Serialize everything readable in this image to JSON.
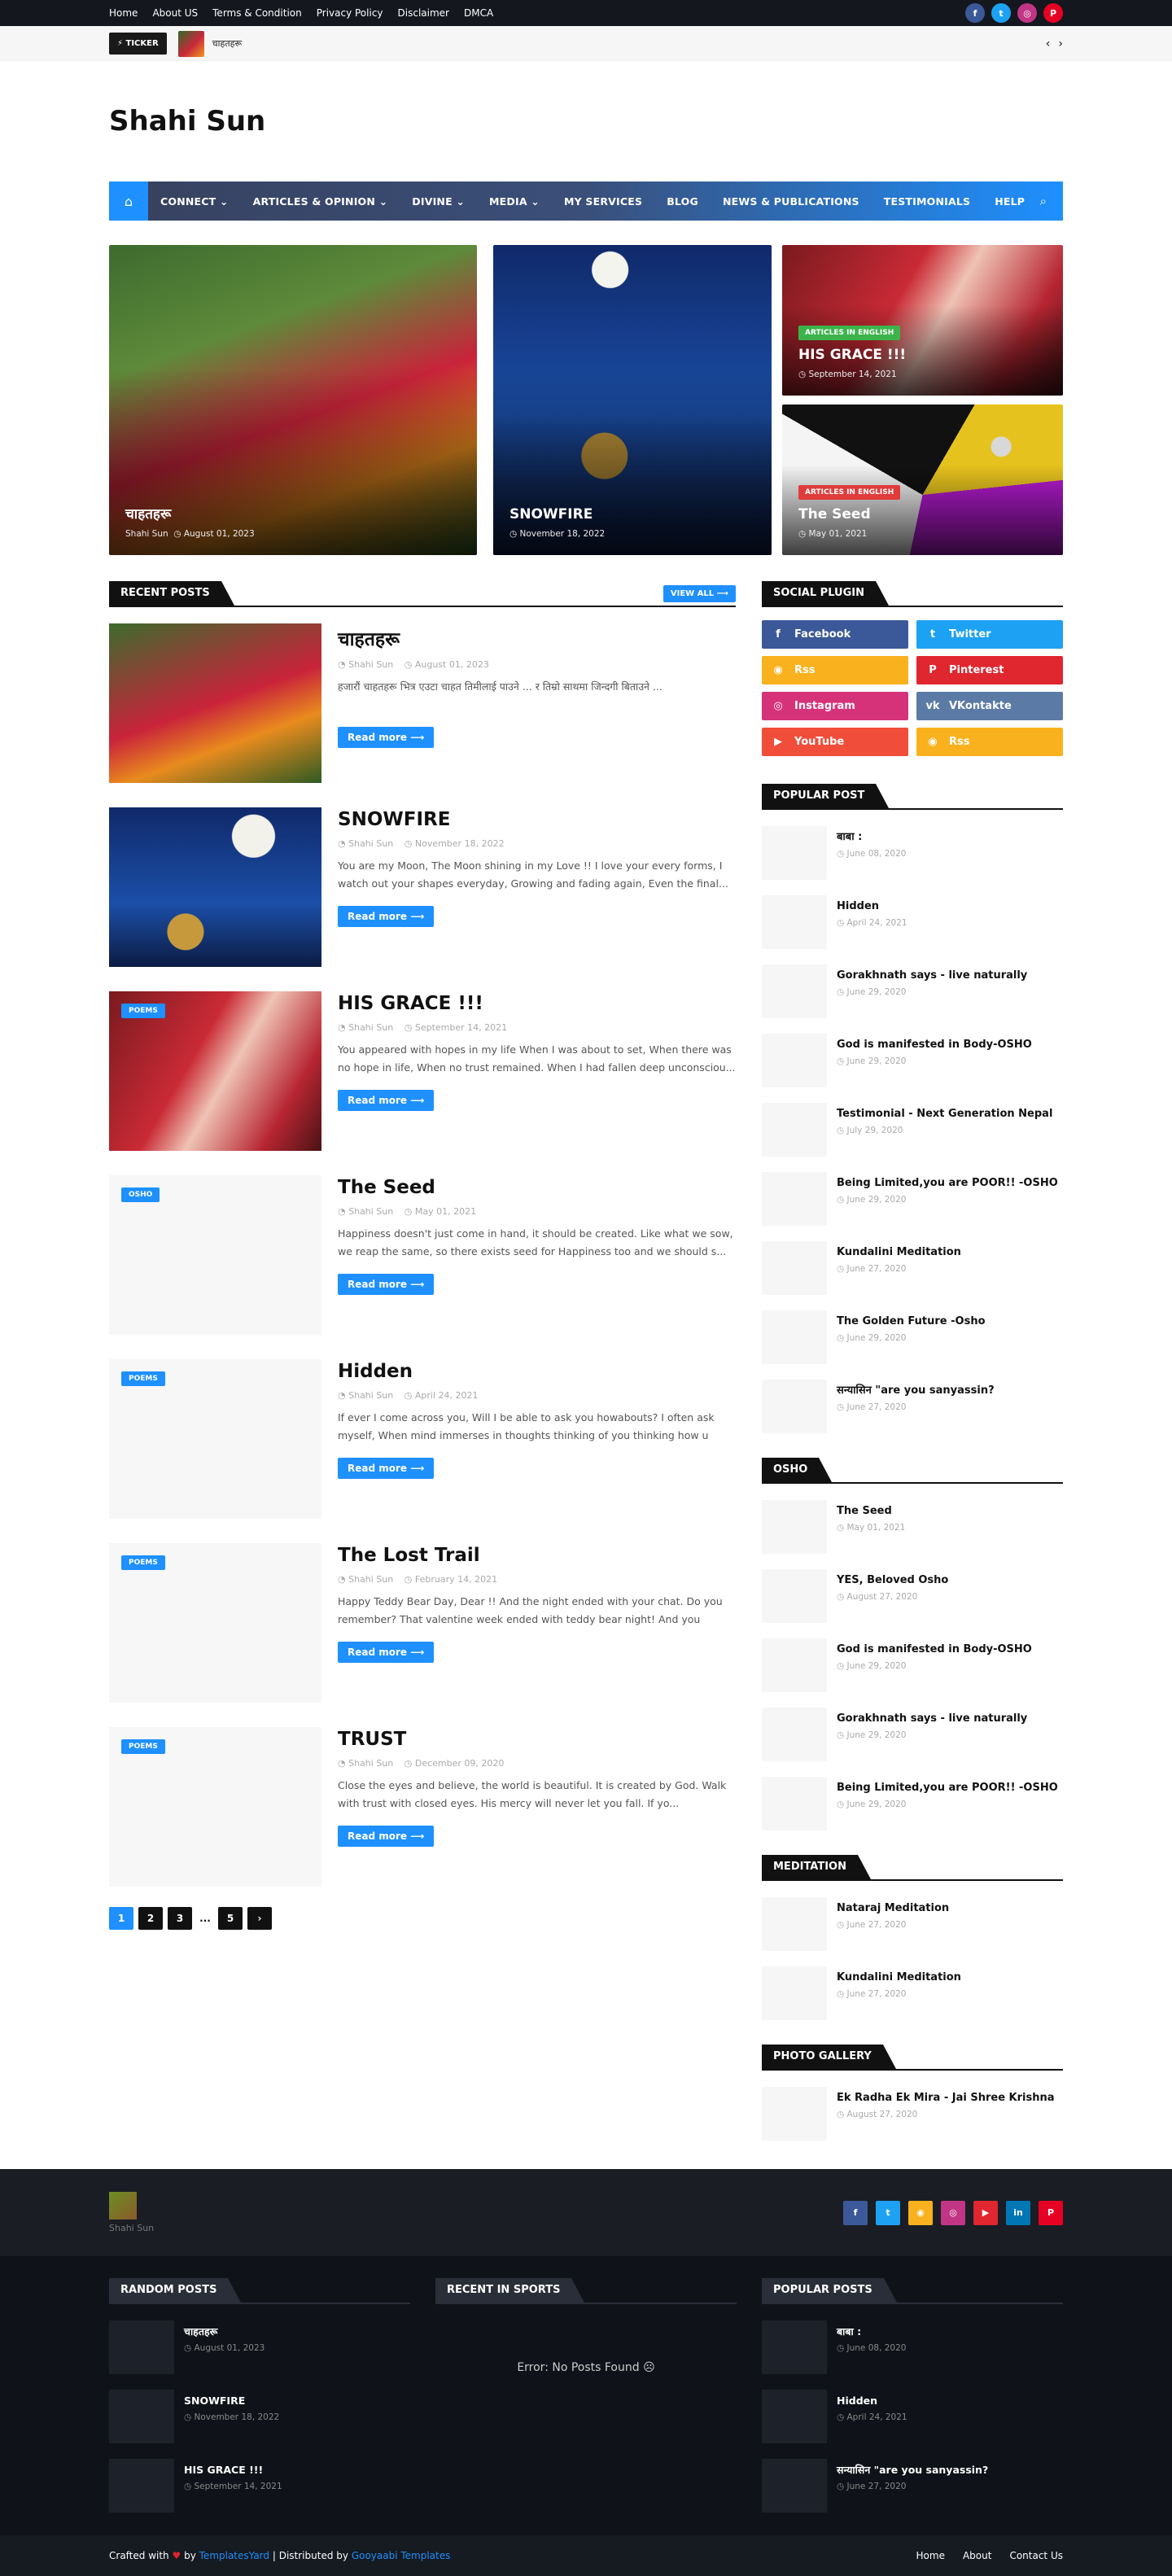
{
  "topbar": {
    "links": [
      "Home",
      "About US",
      "Terms & Condition",
      "Privacy Policy",
      "Disclaimer",
      "DMCA"
    ],
    "social": [
      {
        "icon": "facebook-icon",
        "glyph": "f",
        "color": "#3b5998"
      },
      {
        "icon": "twitter-icon",
        "glyph": "t",
        "color": "#1da1f2"
      },
      {
        "icon": "instagram-icon",
        "glyph": "◎",
        "color": "#c13584"
      },
      {
        "icon": "pinterest-icon",
        "glyph": "P",
        "color": "#e60023"
      }
    ]
  },
  "ticker": {
    "label": "⚡ TICKER",
    "text": "चाहतहरू",
    "prev": "‹",
    "next": "›"
  },
  "header": {
    "site_title": "Shahi Sun"
  },
  "nav": {
    "home_icon": "⌂",
    "items": [
      "CONNECT ⌄",
      "ARTICLES & OPINION ⌄",
      "DIVINE ⌄",
      "MEDIA ⌄",
      "MY SERVICES",
      "BLOG",
      "NEWS & PUBLICATIONS",
      "TESTIMONIALS",
      "HELP"
    ],
    "search_icon": "⌕"
  },
  "featured": [
    {
      "title": "चाहतहरू",
      "author": "Shahi Sun",
      "date": "August 01, 2023",
      "tag": ""
    },
    {
      "title": "SNOWFIRE",
      "author": "",
      "date": "November 18, 2022",
      "tag": ""
    },
    {
      "title": "HIS GRACE !!!",
      "author": "",
      "date": "September 14, 2021",
      "tag": "ARTICLES IN ENGLISH",
      "tag_color": "#3cb44b"
    },
    {
      "title": "The Seed",
      "author": "",
      "date": "May 01, 2021",
      "tag": "ARTICLES IN ENGLISH",
      "tag_color": "#e03c3c"
    }
  ],
  "recent": {
    "heading": "RECENT POSTS",
    "view_all": "VIEW ALL ⟶",
    "read_more": "Read more ⟶",
    "posts": [
      {
        "title": "चाहतहरू",
        "author": "Shahi Sun",
        "date": "August 01, 2023",
        "excerpt": "हजारौं चाहतहरू भित्र एउटा चाहत तिमीलाई पाउने ... र तिम्रो साथमा जिन्दगी बिताउने ...",
        "badge": ""
      },
      {
        "title": "SNOWFIRE",
        "author": "Shahi Sun",
        "date": "November 18, 2022",
        "excerpt": "You are my Moon, The Moon shining in my Love !! I love your every forms, I watch out your shapes everyday, Growing and fading again, Even the final...",
        "badge": ""
      },
      {
        "title": "HIS GRACE !!!",
        "author": "Shahi Sun",
        "date": "September 14, 2021",
        "excerpt": "You appeared with hopes in my life When I was about to set, When there was no hope in life, When no trust remained. When I had fallen deep unconsciou...",
        "badge": "POEMS"
      },
      {
        "title": "The Seed",
        "author": "Shahi Sun",
        "date": "May 01, 2021",
        "excerpt": "Happiness doesn't just come in hand, it should be created. Like what we sow, we reap the same, so there exists seed for Happiness too and we should s...",
        "badge": "OSHO"
      },
      {
        "title": "Hidden",
        "author": "Shahi Sun",
        "date": "April 24, 2021",
        "excerpt": "If ever I come across you, Will I be able to ask you howabouts? I often ask myself, When mind immerses in thoughts thinking of you thinking how u mus...",
        "badge": "POEMS"
      },
      {
        "title": "The Lost Trail",
        "author": "Shahi Sun",
        "date": "February 14, 2021",
        "excerpt": "Happy Teddy Bear Day, Dear !!  And the night ended with your chat. Do you remember? That valentine week ended with teddy bear night! And you promised...",
        "badge": "POEMS"
      },
      {
        "title": "TRUST",
        "author": "Shahi Sun",
        "date": "December 09, 2020",
        "excerpt": "Close the eyes and believe, the world is beautiful. It is created by God. Walk with trust with closed eyes. His mercy will never let you fall. If yo...",
        "badge": "POEMS"
      }
    ],
    "pager": [
      "1",
      "2",
      "3",
      "...",
      "5",
      "›"
    ]
  },
  "sidebar": {
    "social_heading": "SOCIAL PLUGIN",
    "social": [
      {
        "label": "Facebook",
        "glyph": "f",
        "color": "#3b5998"
      },
      {
        "label": "Twitter",
        "glyph": "t",
        "color": "#1da1f2"
      },
      {
        "label": "Rss",
        "glyph": "◉",
        "color": "#f9b11d"
      },
      {
        "label": "Pinterest",
        "glyph": "P",
        "color": "#e0262f"
      },
      {
        "label": "Instagram",
        "glyph": "◎",
        "color": "#d6327a"
      },
      {
        "label": "VKontakte",
        "glyph": "vk",
        "color": "#5b7ba6"
      },
      {
        "label": "YouTube",
        "glyph": "▶",
        "color": "#f04d3a"
      },
      {
        "label": "Rss",
        "glyph": "◉",
        "color": "#f9b11d"
      }
    ],
    "popular_heading": "POPULAR POST",
    "popular": [
      {
        "title": "बाबा :",
        "date": "June 08, 2020"
      },
      {
        "title": "Hidden",
        "date": "April 24, 2021"
      },
      {
        "title": "Gorakhnath says - live naturally",
        "date": "June 29, 2020"
      },
      {
        "title": "God is manifested in Body-OSHO",
        "date": "June 29, 2020"
      },
      {
        "title": "Testimonial - Next Generation Nepal",
        "date": "July 29, 2020"
      },
      {
        "title": "Being Limited,you are POOR!! -OSHO",
        "date": "June 29, 2020"
      },
      {
        "title": "Kundalini Meditation",
        "date": "June 27, 2020"
      },
      {
        "title": "The Golden Future -Osho",
        "date": "June 29, 2020"
      },
      {
        "title": "सन्यासिन \"are you sanyassin?",
        "date": "June 27, 2020"
      }
    ],
    "osho_heading": "OSHO",
    "osho": [
      {
        "title": "The Seed",
        "date": "May 01, 2021"
      },
      {
        "title": "YES, Beloved Osho",
        "date": "August 27, 2020"
      },
      {
        "title": "God is manifested in Body-OSHO",
        "date": "June 29, 2020"
      },
      {
        "title": "Gorakhnath says - live naturally",
        "date": "June 29, 2020"
      },
      {
        "title": "Being Limited,you are POOR!! -OSHO",
        "date": "June 29, 2020"
      }
    ],
    "meditation_heading": "MEDITATION",
    "meditation": [
      {
        "title": "Nataraj Meditation",
        "date": "June 27, 2020"
      },
      {
        "title": "Kundalini Meditation",
        "date": "June 27, 2020"
      }
    ],
    "gallery_heading": "PHOTO GALLERY",
    "gallery": [
      {
        "title": "Ek Radha Ek Mira - Jai Shree Krishna",
        "date": "August 27, 2020"
      }
    ]
  },
  "footer": {
    "site_name": "Shahi Sun",
    "social": [
      {
        "icon": "facebook-icon",
        "glyph": "f",
        "color": "#3b5998"
      },
      {
        "icon": "twitter-icon",
        "glyph": "t",
        "color": "#1da1f2"
      },
      {
        "icon": "rss-icon",
        "glyph": "◉",
        "color": "#f9b11d"
      },
      {
        "icon": "instagram-icon",
        "glyph": "◎",
        "color": "#c13584"
      },
      {
        "icon": "youtube-icon",
        "glyph": "▶",
        "color": "#e0262f"
      },
      {
        "icon": "linkedin-icon",
        "glyph": "in",
        "color": "#0077b5"
      },
      {
        "icon": "pinterest-icon",
        "glyph": "P",
        "color": "#e60023"
      }
    ],
    "random_heading": "RANDOM POSTS",
    "random": [
      {
        "title": "चाहतहरू",
        "date": "August 01, 2023"
      },
      {
        "title": "SNOWFIRE",
        "date": "November 18, 2022"
      },
      {
        "title": "HIS GRACE !!!",
        "date": "September 14, 2021"
      }
    ],
    "sports_heading": "RECENT IN SPORTS",
    "sports_error": "Error: No Posts Found ☹",
    "popular_heading": "POPULAR POSTS",
    "popular": [
      {
        "title": "बाबा :",
        "date": "June 08, 2020"
      },
      {
        "title": "Hidden",
        "date": "April 24, 2021"
      },
      {
        "title": "सन्यासिन \"are you sanyassin?",
        "date": "June 27, 2020"
      }
    ],
    "credit_prefix": "Crafted with",
    "credit_heart": "♥",
    "credit_by": "by",
    "credit_brand": "TemplatesYard",
    "credit_sep": "| Distributed by",
    "credit_dist": "Gooyaabi Templates",
    "menu": [
      "Home",
      "About",
      "Contact Us"
    ]
  }
}
